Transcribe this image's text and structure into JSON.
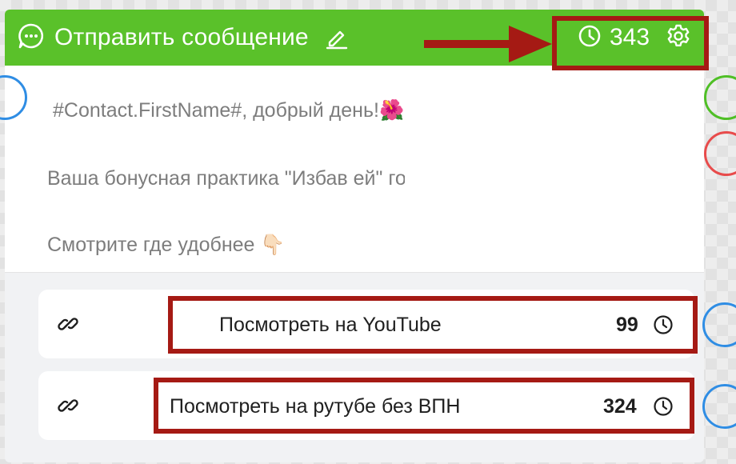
{
  "header": {
    "title": "Отправить сообщение",
    "count": "343",
    "icons": [
      "chat-bubble-icon",
      "pencil-icon",
      "clock-icon",
      "gear-icon"
    ],
    "color": "#5ac12a"
  },
  "message": {
    "line1": "#Contact.FirstName#, добрый день!🌺",
    "line2": "Ваша бонусная практика \"Избав                              ей\" готова.",
    "line3": "Смотрите где удобнее 👇🏻"
  },
  "buttons": [
    {
      "label": "Посмотреть на YouTube",
      "count": "99"
    },
    {
      "label": "Посмотреть на рутубе без ВПН",
      "count": "324"
    }
  ],
  "colors": {
    "highlight": "#a51a14",
    "port_blue": "#2f8de4",
    "port_green": "#4fbf26",
    "port_red": "#e84b4b"
  }
}
